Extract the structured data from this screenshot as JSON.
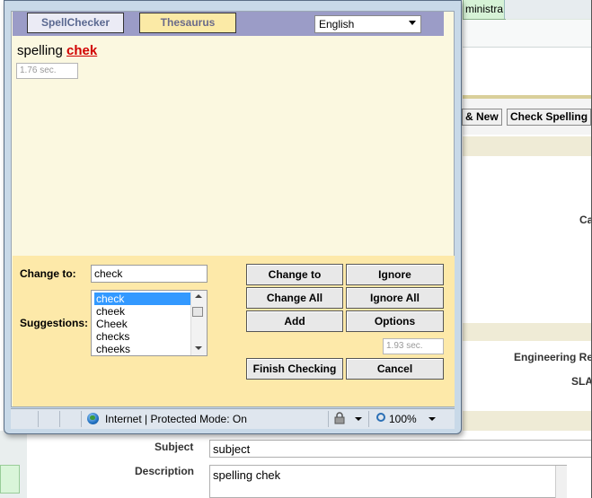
{
  "background_page": {
    "tab_label": "ministra",
    "buttons": {
      "new": "& New",
      "check_spelling": "Check Spelling"
    },
    "labels": {
      "ca": "Ca",
      "engineering": "Engineering Req",
      "sla": "SLA",
      "subject": "Subject",
      "description": "Description"
    },
    "fields": {
      "subject_value": "subject",
      "description_value": "spelling chek"
    }
  },
  "popup": {
    "tabs": {
      "spellchecker": "SpellChecker",
      "thesaurus": "Thesaurus"
    },
    "language": "English",
    "text_prefix": "spelling",
    "misspelled_word": "chek",
    "timer_top": "1.76 sec.",
    "change_to_label": "Change to:",
    "change_to_value": "check",
    "suggestions_label": "Suggestions:",
    "suggestions": [
      "check",
      "cheek",
      "Cheek",
      "checks",
      "cheeks"
    ],
    "selected_suggestion": "check",
    "buttons": {
      "change_to": "Change to",
      "ignore": "Ignore",
      "change_all": "Change All",
      "ignore_all": "Ignore All",
      "add": "Add",
      "options": "Options",
      "finish": "Finish Checking",
      "cancel": "Cancel"
    },
    "timer_bottom": "1.93 sec.",
    "status": {
      "zone": "Internet | Protected Mode: On",
      "zoom": "100%"
    }
  }
}
